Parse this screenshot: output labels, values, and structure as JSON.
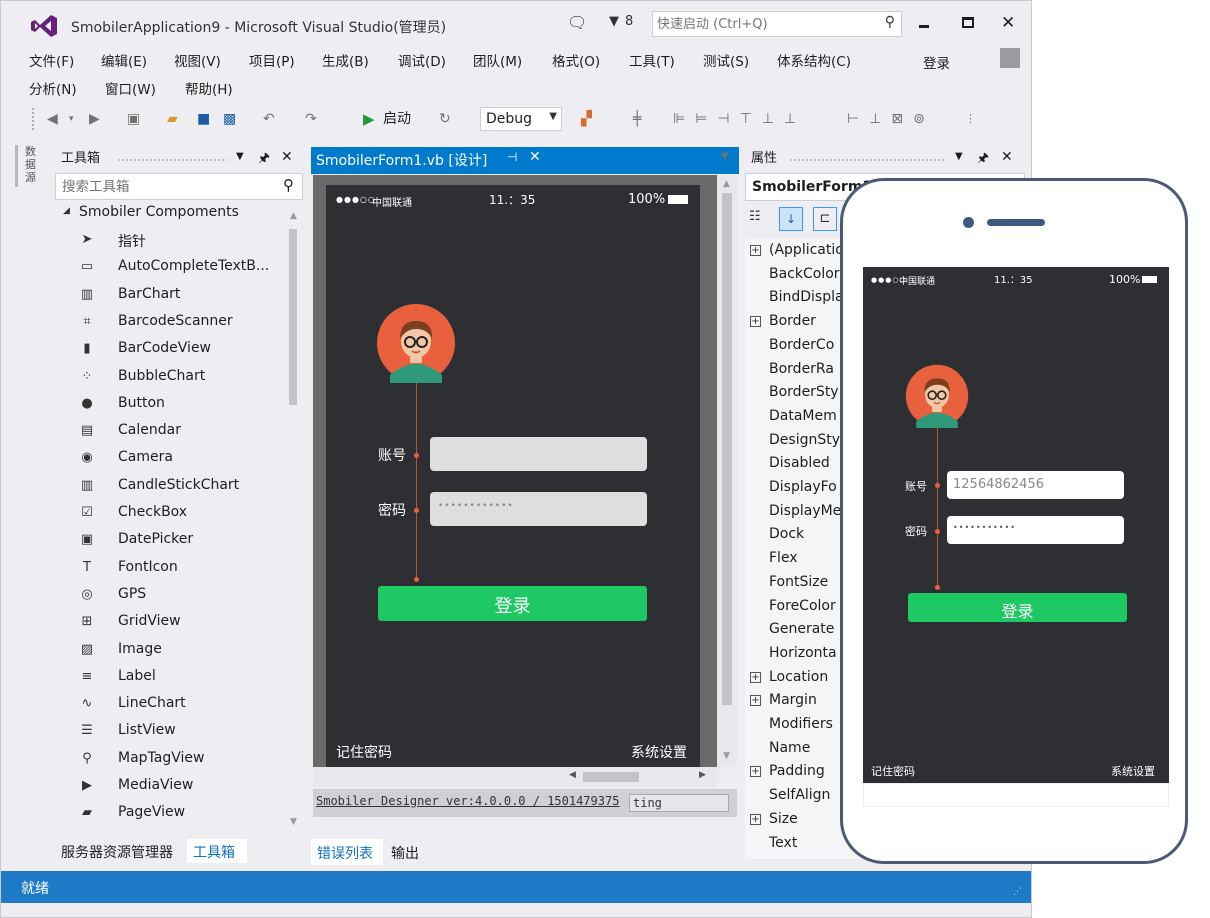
{
  "window": {
    "title": "SmobilerApplication9 - Microsoft Visual Studio(管理员)",
    "notifications_count": "8",
    "quick_launch_placeholder": "快速启动 (Ctrl+Q)",
    "signin": "登录"
  },
  "menu": {
    "row1": [
      "文件(F)",
      "编辑(E)",
      "视图(V)",
      "项目(P)",
      "生成(B)",
      "调试(D)",
      "团队(M)",
      "格式(O)",
      "工具(T)",
      "测试(S)",
      "体系结构(C)"
    ],
    "row2": [
      "分析(N)",
      "窗口(W)",
      "帮助(H)"
    ]
  },
  "toolbar": {
    "start_label": "启动",
    "config_value": "Debug"
  },
  "side_tab": "数据源",
  "toolbox": {
    "title": "工具箱",
    "search_placeholder": "搜索工具箱",
    "group": "Smobiler Compoments",
    "items": [
      {
        "label": "指针",
        "icon": "pointer-icon"
      },
      {
        "label": "AutoCompleteTextB...",
        "icon": "autocomplete-icon"
      },
      {
        "label": "BarChart",
        "icon": "bar-chart-icon"
      },
      {
        "label": "BarcodeScanner",
        "icon": "scanner-icon"
      },
      {
        "label": "BarCodeView",
        "icon": "barcode-icon"
      },
      {
        "label": "BubbleChart",
        "icon": "bubble-chart-icon"
      },
      {
        "label": "Button",
        "icon": "button-icon"
      },
      {
        "label": "Calendar",
        "icon": "calendar-icon"
      },
      {
        "label": "Camera",
        "icon": "camera-icon"
      },
      {
        "label": "CandleStickChart",
        "icon": "candlestick-icon"
      },
      {
        "label": "CheckBox",
        "icon": "checkbox-icon"
      },
      {
        "label": "DatePicker",
        "icon": "datepicker-icon"
      },
      {
        "label": "FontIcon",
        "icon": "fonticon-icon"
      },
      {
        "label": "GPS",
        "icon": "gps-icon"
      },
      {
        "label": "GridView",
        "icon": "grid-icon"
      },
      {
        "label": "Image",
        "icon": "image-icon"
      },
      {
        "label": "Label",
        "icon": "label-icon"
      },
      {
        "label": "LineChart",
        "icon": "line-chart-icon"
      },
      {
        "label": "ListView",
        "icon": "list-icon"
      },
      {
        "label": "MapTagView",
        "icon": "map-pin-icon"
      },
      {
        "label": "MediaView",
        "icon": "media-icon"
      },
      {
        "label": "PageView",
        "icon": "page-icon"
      }
    ],
    "bottom_tabs": [
      "服务器资源管理器",
      "工具箱"
    ]
  },
  "designer": {
    "tab_title": "SmobilerForm1.vb [设计]",
    "status_carrier": "中国联通",
    "status_time": "11.：35",
    "status_battery": "100%",
    "account_label": "账号",
    "password_label": "密码",
    "password_value": "••••••••••••",
    "login_button": "登录",
    "remember_label": "记住密码",
    "settings_label": "系统设置",
    "version_text": "Smobiler Designer ver:4.0.0.0 / 1501479375",
    "version_tail": "ting",
    "bottom_tabs": [
      "错误列表",
      "输出"
    ]
  },
  "properties": {
    "title": "属性",
    "object": "SmobilerForm1",
    "items": [
      {
        "label": "(Applicatio",
        "expand": true
      },
      {
        "label": "BackColor",
        "expand": false
      },
      {
        "label": "BindDispla",
        "expand": false
      },
      {
        "label": "Border",
        "expand": true
      },
      {
        "label": "BorderCo",
        "expand": false
      },
      {
        "label": "BorderRa",
        "expand": false
      },
      {
        "label": "BorderSty",
        "expand": false
      },
      {
        "label": "DataMem",
        "expand": false
      },
      {
        "label": "DesignSty",
        "expand": false
      },
      {
        "label": "Disabled",
        "expand": false
      },
      {
        "label": "DisplayFo",
        "expand": false
      },
      {
        "label": "DisplayMe",
        "expand": false
      },
      {
        "label": "Dock",
        "expand": false
      },
      {
        "label": "Flex",
        "expand": false
      },
      {
        "label": "FontSize",
        "expand": false
      },
      {
        "label": "ForeColor",
        "expand": false
      },
      {
        "label": "Generate",
        "expand": false
      },
      {
        "label": "Horizonta",
        "expand": false
      },
      {
        "label": "Location",
        "expand": true
      },
      {
        "label": "Margin",
        "expand": true
      },
      {
        "label": "Modifiers",
        "expand": false
      },
      {
        "label": "Name",
        "expand": false
      },
      {
        "label": "Padding",
        "expand": true
      },
      {
        "label": "SelfAlign",
        "expand": false
      },
      {
        "label": "Size",
        "expand": true
      },
      {
        "label": "Text",
        "expand": false
      }
    ]
  },
  "statusbar": {
    "text": "就绪"
  },
  "phone_preview": {
    "status_carrier": "中国联通",
    "status_time": "11.：35",
    "status_battery": "100%",
    "account_label": "账号",
    "account_value": "12564862456",
    "password_label": "密码",
    "password_value": "•••••••••••",
    "login_button": "登录",
    "remember_label": "记住密码",
    "settings_label": "系统设置"
  },
  "colors": {
    "accent_blue": "#007acc",
    "status_blue": "#1e7ac6",
    "login_green": "#1ec863",
    "phone_dark": "#2e2f33",
    "avatar_orange": "#e8613c"
  }
}
